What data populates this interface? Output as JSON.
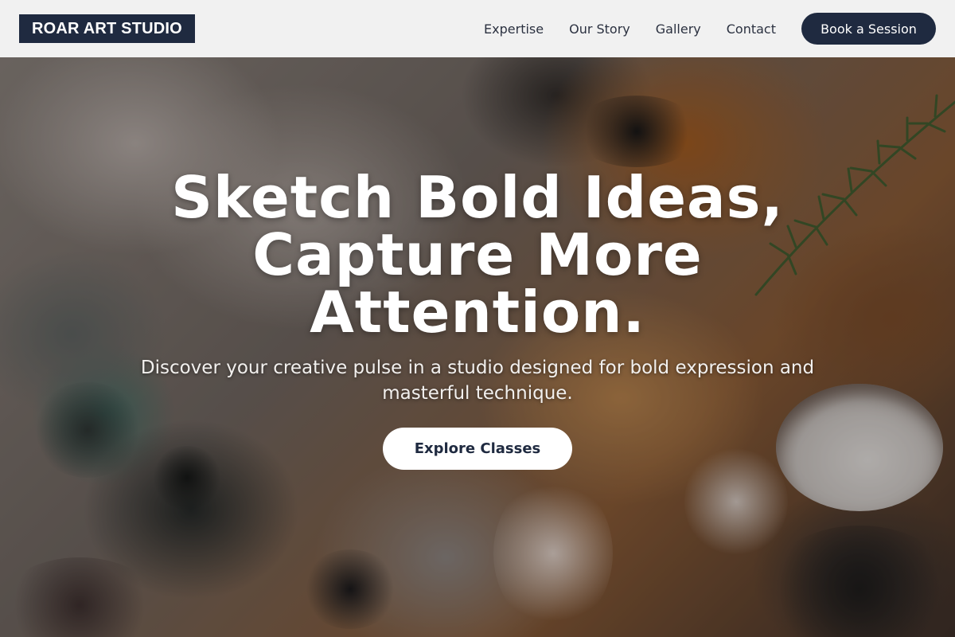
{
  "header": {
    "logo": "ROAR ART STUDIO",
    "nav": [
      {
        "label": "Expertise"
      },
      {
        "label": "Our Story"
      },
      {
        "label": "Gallery"
      },
      {
        "label": "Contact"
      }
    ],
    "cta_label": "Book a Session"
  },
  "hero": {
    "title": "Sketch Bold Ideas, Capture More Attention.",
    "subtitle": "Discover your creative pulse in a studio designed for bold expression and masterful technique.",
    "cta_label": "Explore Classes",
    "background": "textured-oil-paint-palette"
  },
  "colors": {
    "brand": "#1f2a40",
    "header_bg": "#f1f1f1",
    "hero_text": "#ffffff"
  }
}
